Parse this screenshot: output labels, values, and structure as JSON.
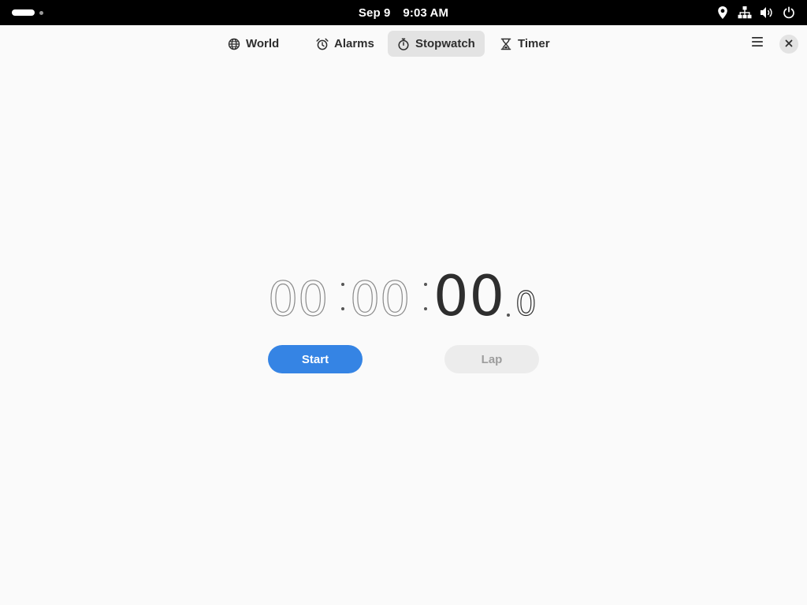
{
  "system": {
    "date": "Sep 9",
    "time": "9:03 AM",
    "tray_icons": [
      "location-icon",
      "network-icon",
      "volume-icon",
      "power-icon"
    ]
  },
  "header": {
    "tabs": [
      {
        "label": "World",
        "icon": "globe-icon",
        "active": false
      },
      {
        "label": "Alarms",
        "icon": "alarm-clock-icon",
        "active": false
      },
      {
        "label": "Stopwatch",
        "icon": "stopwatch-icon",
        "active": true
      },
      {
        "label": "Timer",
        "icon": "hourglass-icon",
        "active": false
      }
    ],
    "menu_icon": "hamburger-menu-icon",
    "close_icon": "close-icon"
  },
  "stopwatch": {
    "hours": "00",
    "minutes": "00",
    "seconds": "00",
    "tenths": "0"
  },
  "buttons": {
    "start_label": "Start",
    "lap_label": "Lap"
  },
  "colors": {
    "accent": "#3584e4",
    "topbar": "#000000",
    "background": "#fafafa"
  }
}
